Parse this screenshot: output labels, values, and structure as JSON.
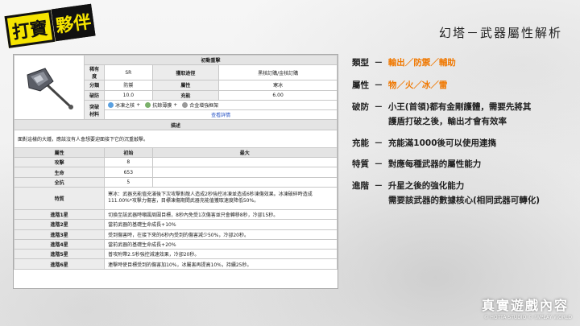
{
  "logo": {
    "part1": "打寶",
    "part2": "夥伴"
  },
  "page_title": "幻塔－武器屬性解析",
  "weapon_table": {
    "name": "初動重擊",
    "rarity_label": "稀有度",
    "rarity": "SR",
    "source_label": "獲取途徑",
    "source": "黑核訂購/金核訂購",
    "category_label": "分類",
    "category": "防禦",
    "element_label": "屬性",
    "element": "寒冰",
    "shatter_label": "破防",
    "shatter": "10.0",
    "charge_label": "充能",
    "charge": "6.00",
    "materials_label": "突破材料",
    "materials": [
      {
        "name": "冰凍之核",
        "suffix": "+",
        "color": "#5aa0e0"
      },
      {
        "name": "抗餘薄膜",
        "suffix": "+",
        "color": "#7ab06a"
      },
      {
        "name": "合金增強框架",
        "suffix": "",
        "color": "#999999"
      }
    ],
    "details_link": "查看詳情",
    "desc_label": "描述",
    "description": "面對這樣的大鍾，應該沒有人會想要迎面接下它的沉重敲擊。",
    "stats_header": {
      "label": "屬性",
      "initial": "初始",
      "max": "最大"
    },
    "stats": [
      {
        "name": "攻擊",
        "initial": "8",
        "max": ""
      },
      {
        "name": "生命",
        "initial": "653",
        "max": ""
      },
      {
        "name": "全抗",
        "initial": "5",
        "max": ""
      }
    ],
    "trait_label": "特質",
    "trait": "寒冰：武器充能值充滿後下次攻擊對敵人造成2秒強控冰凍並造成6秒凍傷效果。冰凍破碎時造成111.00%*攻擊力傷害，目標凍傷期間武器充能值獲取速度降低50%。",
    "advances": [
      {
        "label": "進階1星",
        "text": "切換至該武器時嘲諷周圍目標，8秒內免受1次傷害並只會轉移8秒，冷卻15秒。"
      },
      {
        "label": "進階2星",
        "text": "當前武器的基礎生命成長+10%"
      },
      {
        "label": "進階3星",
        "text": "受到傷害時，在接下來的6秒內受到的傷害減少50%，冷卻20秒。"
      },
      {
        "label": "進階4星",
        "text": "當前武器的基礎生命成長+20%"
      },
      {
        "label": "進階5星",
        "text": "普攻附帶2.5秒強控減速效果，冷卻20秒。"
      },
      {
        "label": "進階6星",
        "text": "連擊時使目標受到的傷害加10%，冰屬害再提高10%，持續25秒。"
      }
    ]
  },
  "info": {
    "type_label": "類型",
    "dash": "－",
    "types": [
      "輸出",
      "防禦",
      "輔助"
    ],
    "element_label": "屬性",
    "elements": [
      "物",
      "火",
      "冰",
      "雷"
    ],
    "shatter_label": "破防",
    "shatter_line1": "小王(首領)都有金剛護體，需要先將其",
    "shatter_line2": "護盾打破之後，輸出才會有效率",
    "charge_label": "充能",
    "charge_text": "充能滿1000後可以使用連擕",
    "trait_label": "特質",
    "trait_text": "對應每種武器的屬性能力",
    "advance_label": "進階",
    "advance_line1": "升星之後的強化能力",
    "advance_line2": "需要該武器的數據核心(相同武器可轉化)"
  },
  "watermark": "真實遊戲內容",
  "copyright": "© HOTTA STUDIO © IWPLAY WORLD",
  "colors": {
    "accent": "#f07800",
    "logo_yellow": "#f5e400"
  }
}
